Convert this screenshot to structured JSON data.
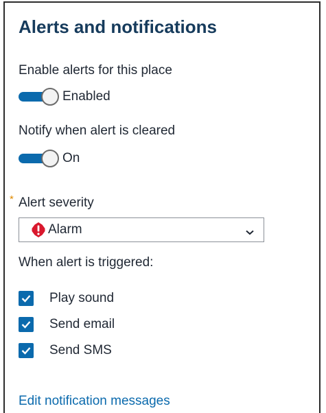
{
  "panel": {
    "title": "Alerts and notifications"
  },
  "enable_alerts": {
    "label": "Enable alerts for this place",
    "state_text": "Enabled",
    "on": true
  },
  "notify_cleared": {
    "label": "Notify when alert is cleared",
    "state_text": "On",
    "on": true
  },
  "severity": {
    "required_marker": "*",
    "label": "Alert severity",
    "selected": "Alarm",
    "icon": "alarm-exclamation-icon",
    "icon_color": "#d9182d"
  },
  "triggered": {
    "heading": "When alert is triggered:",
    "options": [
      {
        "label": "Play sound",
        "checked": true
      },
      {
        "label": "Send email",
        "checked": true
      },
      {
        "label": "Send SMS",
        "checked": true
      }
    ]
  },
  "footer": {
    "link": "Edit notification messages"
  },
  "colors": {
    "accent": "#0b6aad",
    "title": "#163b5c",
    "required": "#e08a00"
  }
}
